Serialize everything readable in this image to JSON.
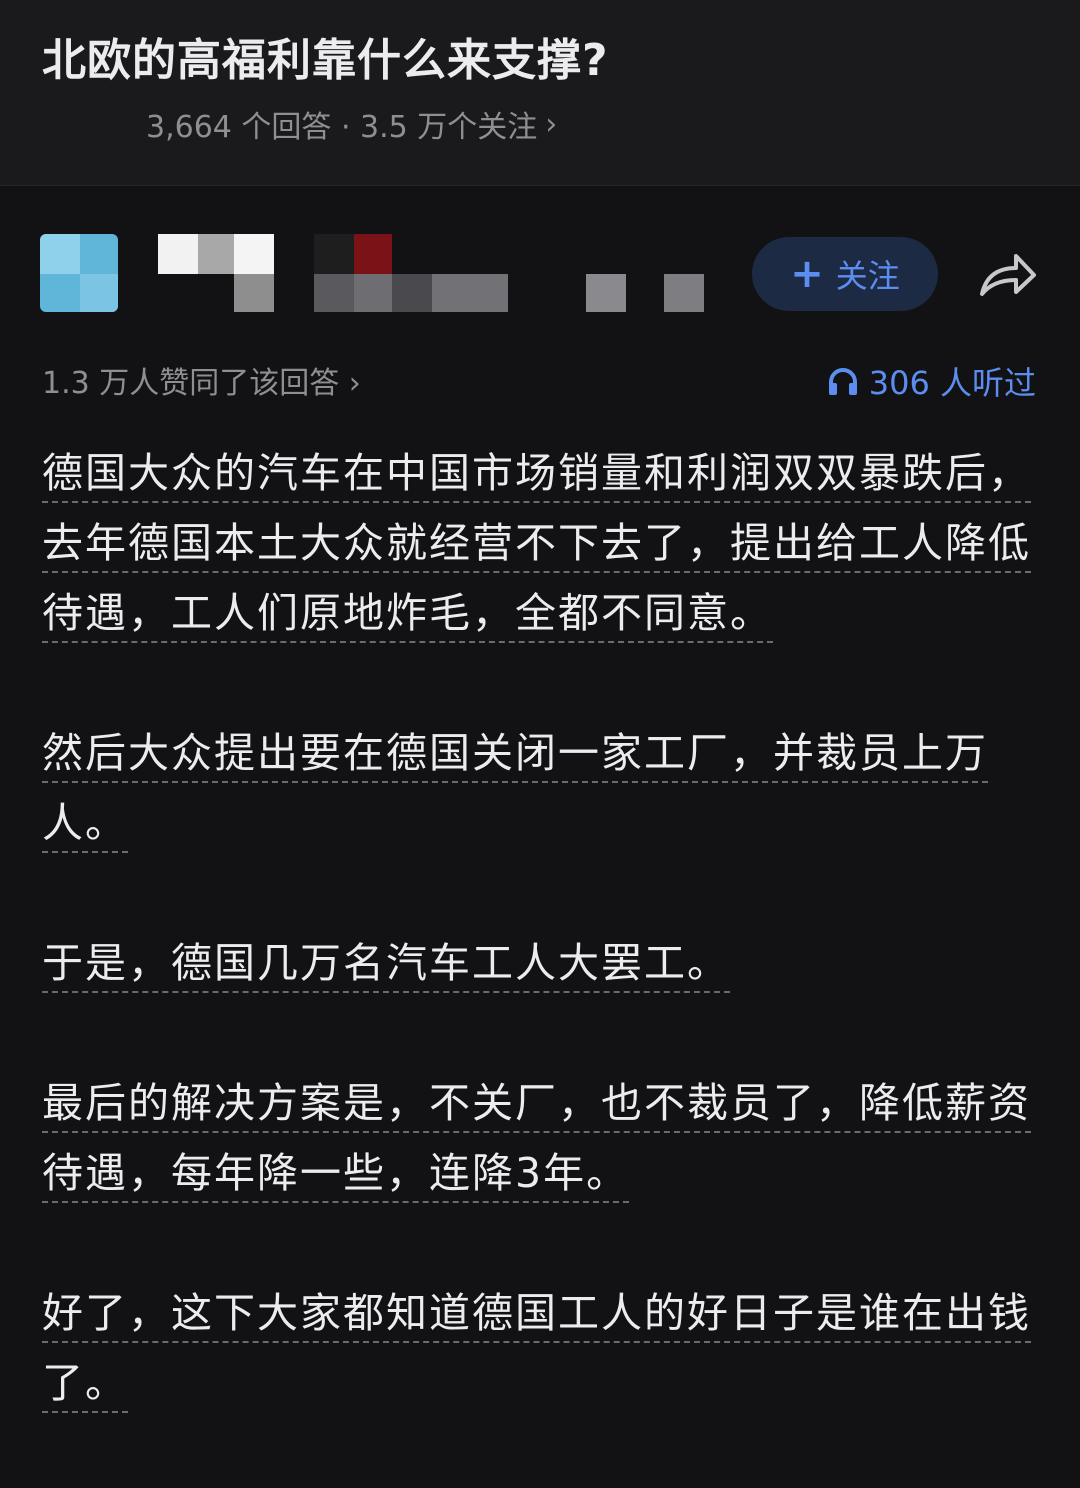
{
  "question": {
    "title": "北欧的高福利靠什么来支撑?",
    "meta": "3,664 个回答 · 3.5 万个关注"
  },
  "author": {
    "follow_label": "关注"
  },
  "stats": {
    "likes": "1.3 万人赞同了该回答",
    "listened": "306 人听过"
  },
  "colors": {
    "background": "#121214",
    "accent": "#5b8ef0",
    "muted": "#8e8e93",
    "text": "#ececee"
  },
  "icons": {
    "follow": "plus-icon",
    "share": "share-arrow-icon",
    "listen": "headphones-icon",
    "more": "chevron-right-icon"
  },
  "paragraphs": [
    "德国大众的汽车在中国市场销量和利润双双暴跌后，去年德国本土大众就经营不下去了，提出给工人降低待遇，工人们原地炸毛，全都不同意。",
    "然后大众提出要在德国关闭一家工厂，并裁员上万人。",
    "于是，德国几万名汽车工人大罢工。",
    "最后的解决方案是，不关厂，也不裁员了，降低薪资待遇，每年降一些，连降3年。",
    "好了，这下大家都知道德国工人的好日子是谁在出钱了。"
  ]
}
